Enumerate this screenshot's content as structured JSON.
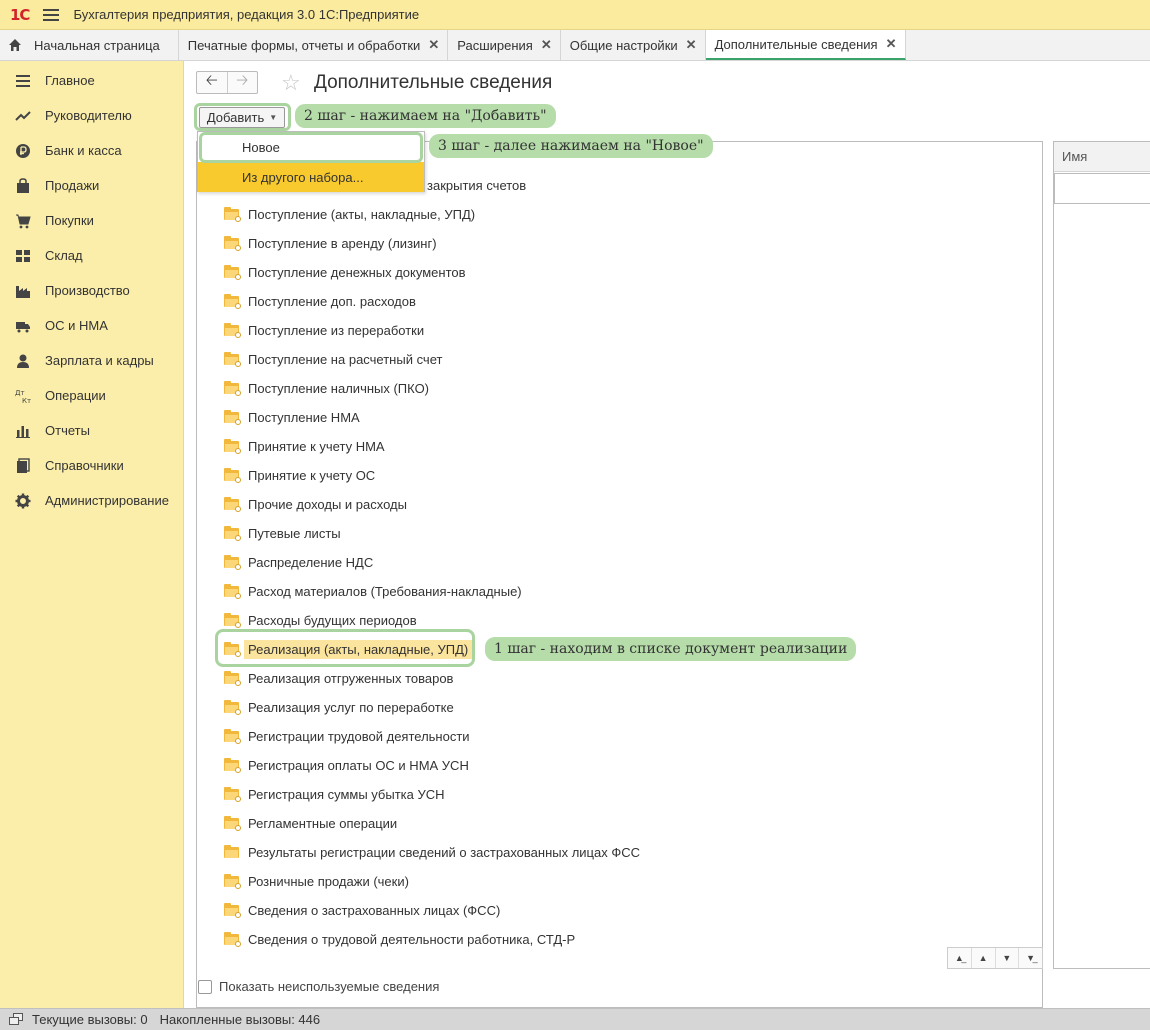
{
  "app": {
    "logo": "1С",
    "title": "Бухгалтерия предприятия, редакция 3.0 1С:Предприятие"
  },
  "tabs": [
    {
      "label": "Начальная страница"
    },
    {
      "label": "Печатные формы, отчеты и обработки"
    },
    {
      "label": "Расширения"
    },
    {
      "label": "Общие настройки"
    },
    {
      "label": "Дополнительные сведения"
    }
  ],
  "tab_close_glyph": "✕",
  "sidebar": {
    "items": [
      {
        "label": "Главное",
        "icon": "list-icon"
      },
      {
        "label": "Руководителю",
        "icon": "trend-icon"
      },
      {
        "label": "Банк и касса",
        "icon": "ruble-icon"
      },
      {
        "label": "Продажи",
        "icon": "bag-icon"
      },
      {
        "label": "Покупки",
        "icon": "cart-icon"
      },
      {
        "label": "Склад",
        "icon": "warehouse-icon"
      },
      {
        "label": "Производство",
        "icon": "factory-icon"
      },
      {
        "label": "ОС и НМА",
        "icon": "truck-icon"
      },
      {
        "label": "Зарплата и кадры",
        "icon": "person-icon"
      },
      {
        "label": "Операции",
        "icon": "dt-kt-icon"
      },
      {
        "label": "Отчеты",
        "icon": "bar-chart-icon"
      },
      {
        "label": "Справочники",
        "icon": "books-icon"
      },
      {
        "label": "Администрирование",
        "icon": "gear-icon"
      }
    ]
  },
  "page": {
    "title": "Дополнительные сведения",
    "add_label": "Добавить",
    "dropdown": {
      "new_label": "Новое",
      "from_set_label": "Из другого набора..."
    },
    "partial_row": "закрытия счетов",
    "rows": [
      "Поступление (акты, накладные, УПД)",
      "Поступление в аренду (лизинг)",
      "Поступление денежных документов",
      "Поступление доп. расходов",
      "Поступление из переработки",
      "Поступление на расчетный счет",
      "Поступление наличных (ПКО)",
      "Поступление НМА",
      "Принятие к учету НМА",
      "Принятие к учету ОС",
      "Прочие доходы и расходы",
      "Путевые листы",
      "Распределение НДС",
      "Расход материалов (Требования-накладные)",
      "Расходы будущих периодов",
      "Реализация (акты, накладные, УПД)",
      "Реализация отгруженных товаров",
      "Реализация услуг по переработке",
      "Регистрации трудовой деятельности",
      "Регистрация оплаты ОС и НМА УСН",
      "Регистрация суммы убытка УСН",
      "Регламентные операции",
      "Результаты регистрации сведений о застрахованных лицах ФСС",
      "Розничные продажи (чеки)",
      "Сведения о застрахованных лицах (ФСС)",
      "Сведения о трудовой деятельности работника, СТД-Р"
    ],
    "selected_row_index": 15,
    "right_column_header": "Имя",
    "show_unused_label": "Показать неиспользуемые сведения"
  },
  "annotations": {
    "step1": "1 шаг - находим в списке документ реализации",
    "step2": "2 шаг - нажимаем на \"Добавить\"",
    "step3": "3 шаг - далее нажимаем на \"Новое\""
  },
  "status": {
    "current_calls": "Текущие вызовы: 0",
    "accumulated_calls": "Накопленные вызовы: 446"
  },
  "colors": {
    "sidebar_bg": "#fbeeab",
    "titlebar_bg": "#fbeb9e",
    "highlight": "#f8ca2d",
    "callout_bg": "#b5dca9",
    "active_tab_underline": "#3aa36a"
  }
}
